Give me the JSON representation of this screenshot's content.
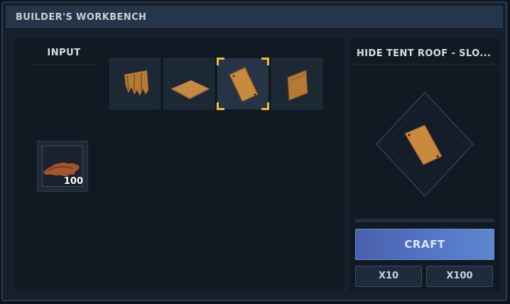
{
  "window": {
    "title": "BUILDER'S WORKBENCH"
  },
  "input": {
    "label": "INPUT",
    "slot": {
      "item": "animal-hide",
      "quantity": "100"
    }
  },
  "recipes": [
    {
      "item": "hide-tent-wall",
      "selected": false
    },
    {
      "item": "hide-tent-floor",
      "selected": false
    },
    {
      "item": "hide-tent-roof-slope",
      "selected": true
    },
    {
      "item": "hide-tent-door",
      "selected": false
    }
  ],
  "details": {
    "item_name": "HIDE TENT ROOF - SLO...",
    "progress": 0,
    "craft_label": "CRAFT",
    "x10_label": "X10",
    "x100_label": "X100"
  },
  "colors": {
    "accent": "#f2b93b",
    "craft_button": "#5478c4",
    "leather": "#c98a3f"
  }
}
